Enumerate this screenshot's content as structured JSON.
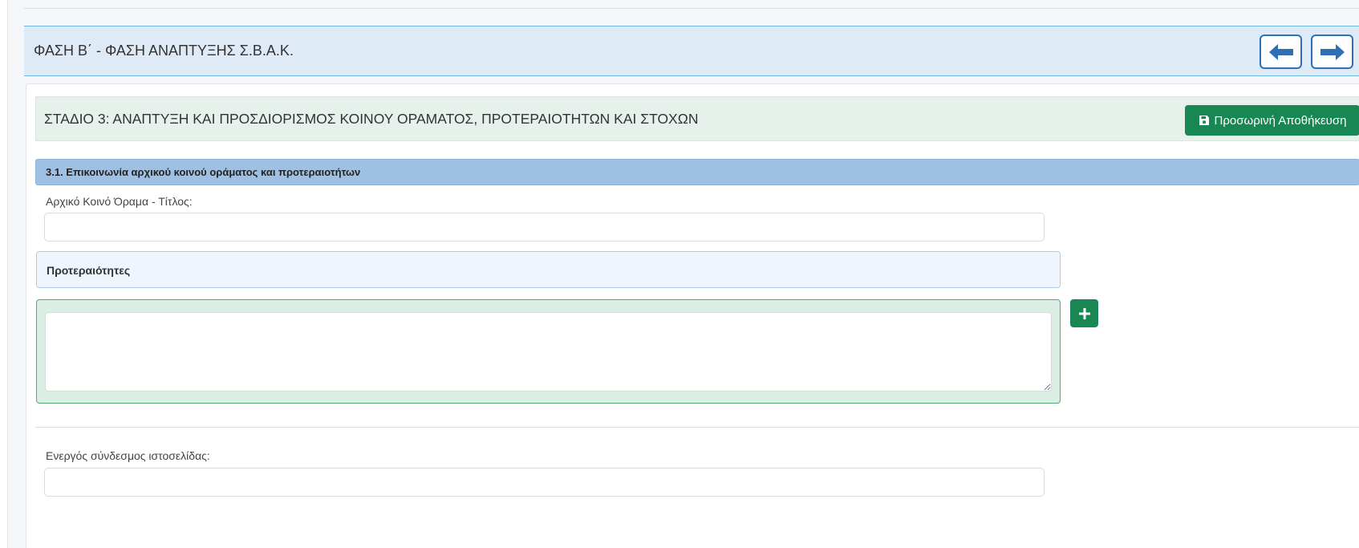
{
  "phase": {
    "title": "ΦΑΣΗ Β΄ - ΦΑΣΗ ΑΝΑΠΤΥΞΗΣ Σ.Β.Α.Κ.",
    "prev_icon": "arrow-left-icon",
    "next_icon": "arrow-right-icon"
  },
  "stage": {
    "title": "ΣΤΑΔΙΟ 3: ΑΝΑΠΤΥΞΗ ΚΑΙ ΠΡΟΣΔΙΟΡΙΣΜΟΣ ΚΟΙΝΟΥ ΟΡΑΜΑΤΟΣ, ΠΡΟΤΕΡΑΙΟΤΗΤΩΝ ΚΑΙ ΣΤΟΧΩΝ",
    "save_label": "Προσωρινή Αποθήκευση",
    "save_icon": "floppy-disk-icon"
  },
  "section": {
    "title": "3.1. Επικοινωνία αρχικού κοινού οράματος και προτεραιοτήτων"
  },
  "vision": {
    "label": "Αρχικό Κοινό Όραμα - Τίτλος:",
    "value": ""
  },
  "priorities": {
    "title": "Προτεραιότητες",
    "items": [
      ""
    ],
    "add_icon": "plus-icon"
  },
  "website": {
    "label": "Ενεργός σύνδεσμος ιστοσελίδας:",
    "value": ""
  },
  "colors": {
    "accent_green": "#198754",
    "accent_blue": "#2f6fb3",
    "section_bar": "#9ec0e2",
    "phase_header_bg": "#dfeaf7",
    "stage_header_bg": "#e7f1ec",
    "priority_card_bg": "#d9efe3"
  }
}
